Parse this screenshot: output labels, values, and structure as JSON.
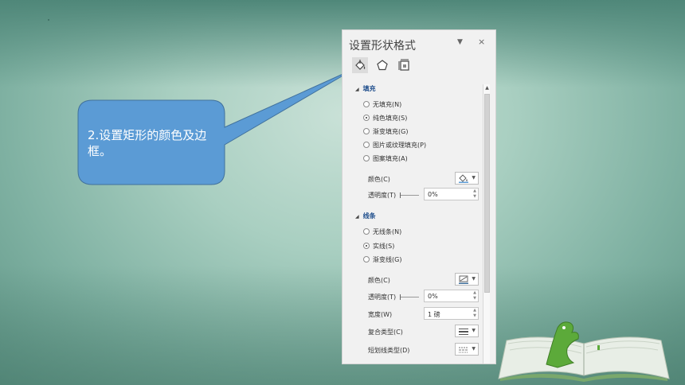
{
  "callout": {
    "text": "2.设置矩形的颜色及边框。",
    "fill_color": "#5b9bd5",
    "border_color": "#41719c"
  },
  "pane": {
    "title": "设置形状格式",
    "dropdown_icon": "caret-down-icon",
    "close_label": "×",
    "tabs": [
      {
        "name": "fill-line",
        "icon": "paint-bucket-icon",
        "active": true
      },
      {
        "name": "effects",
        "icon": "pentagon-icon",
        "active": false
      },
      {
        "name": "size-properties",
        "icon": "size-layout-icon",
        "active": false
      }
    ],
    "fill": {
      "heading": "填充",
      "options": [
        {
          "label": "无填充(N)",
          "selected": false
        },
        {
          "label": "纯色填充(S)",
          "selected": true
        },
        {
          "label": "渐变填充(G)",
          "selected": false
        },
        {
          "label": "图片或纹理填充(P)",
          "selected": false
        },
        {
          "label": "图案填充(A)",
          "selected": false
        }
      ],
      "color_label": "颜色(C)",
      "transparency_label": "透明度(T)",
      "transparency_value": "0%"
    },
    "line": {
      "heading": "线条",
      "options": [
        {
          "label": "无线条(N)",
          "selected": false
        },
        {
          "label": "实线(S)",
          "selected": true
        },
        {
          "label": "渐变线(G)",
          "selected": false
        }
      ],
      "color_label": "颜色(C)",
      "transparency_label": "透明度(T)",
      "transparency_value": "0%",
      "width_label": "宽度(W)",
      "width_value": "1 磅",
      "compound_label": "复合类型(C)",
      "dash_label": "短划线类型(D)"
    }
  }
}
